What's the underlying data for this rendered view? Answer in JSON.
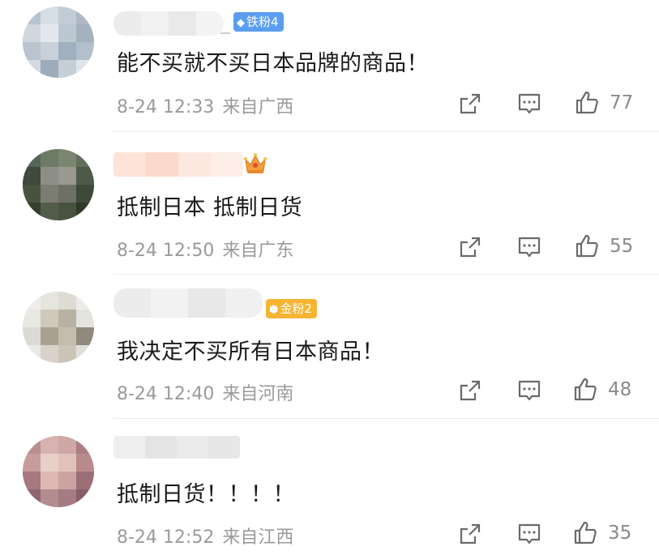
{
  "comments": [
    {
      "badge": "铁粉4",
      "text": "能不买就不买日本品牌的商品！",
      "time": "8-24 12:33",
      "location": "来自广西",
      "likes": "77"
    },
    {
      "text": "抵制日本 抵制日货",
      "time": "8-24 12:50",
      "location": "来自广东",
      "likes": "55"
    },
    {
      "badge": "金粉2",
      "text": "我决定不买所有日本商品！",
      "time": "8-24 12:40",
      "location": "来自河南",
      "likes": "48"
    },
    {
      "text": "抵制日货！！！！",
      "time": "8-24 12:52",
      "location": "来自江西",
      "likes": "35"
    }
  ],
  "icons": {
    "share": "share-icon",
    "comment": "comment-icon",
    "like": "thumbs-up-icon",
    "crown": "crown-icon"
  },
  "colors": {
    "iron_badge": "#5b9df0",
    "gold_badge": "#f5b532",
    "crown": "#f3a03a",
    "text": "#1a1a1a",
    "meta": "#9a9a9a"
  }
}
